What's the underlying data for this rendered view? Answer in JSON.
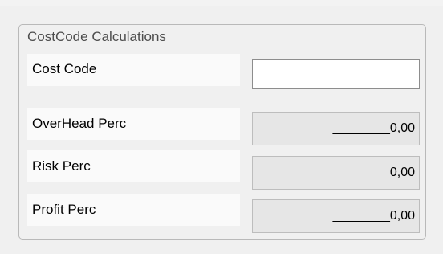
{
  "group": {
    "title": "CostCode Calculations"
  },
  "fields": {
    "cost_code": {
      "label": "Cost Code",
      "value": ""
    },
    "overhead_perc": {
      "label": "OverHead Perc",
      "value": "________0,00"
    },
    "risk_perc": {
      "label": "Risk Perc",
      "value": "________0,00"
    },
    "profit_perc": {
      "label": "Profit Perc",
      "value": "________0,00"
    }
  }
}
